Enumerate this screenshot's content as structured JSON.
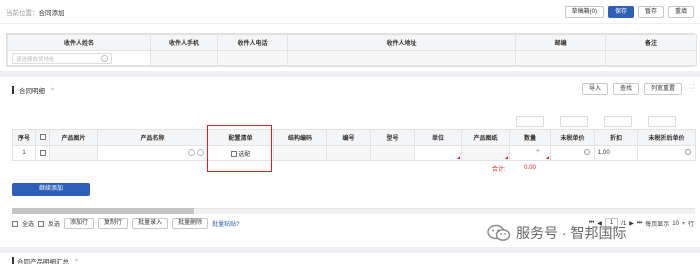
{
  "breadcrumb": {
    "prefix": "当前位置：",
    "current": "合同添加"
  },
  "top_buttons": {
    "draft": "草稿箱(0)",
    "save": "保存",
    "temp": "暂存",
    "reset": "重填"
  },
  "receiver": {
    "headers": [
      "收件人姓名",
      "收件人手机",
      "收件人电话",
      "收件人地址",
      "邮编",
      "备注"
    ],
    "name_placeholder": "请选择收货地址"
  },
  "detail_section": {
    "title": "合同明细",
    "chevron": "^",
    "buttons": {
      "import": "导入",
      "search": "查找",
      "reset_cols": "列宽重置"
    },
    "expand_icon": "⛶",
    "headers": [
      "序号",
      "",
      "产品图片",
      "产品名称",
      "配置清单",
      "结构编码",
      "编号",
      "型号",
      "单位",
      "产品图纸",
      "数量",
      "未税单价",
      "折扣",
      "未税折后单价"
    ],
    "row": {
      "seq": "1",
      "config_label": "选配",
      "discount": "1.00"
    },
    "total_label": "合计:",
    "total_value": "0.00",
    "add_button": "继续添加"
  },
  "bottom_actions": {
    "select_all": "全选",
    "invert": "反选",
    "add_row": "添加行",
    "copy_row": "复制行",
    "batch_entry": "批量录入",
    "batch_delete": "批量删除",
    "batch_paste": "批量粘贴?"
  },
  "pager": {
    "first": "⏮",
    "prev": "◀",
    "page": "1",
    "of_total": "/1",
    "next": "▶",
    "last": "⏭",
    "per_page_label": "每页显示",
    "per_page": "10",
    "per_page_suffix": "行"
  },
  "watermark": {
    "text": "服务号 · 智邦国际"
  },
  "footer_section": {
    "title": "合同产品明细汇总",
    "chevron": "^"
  }
}
